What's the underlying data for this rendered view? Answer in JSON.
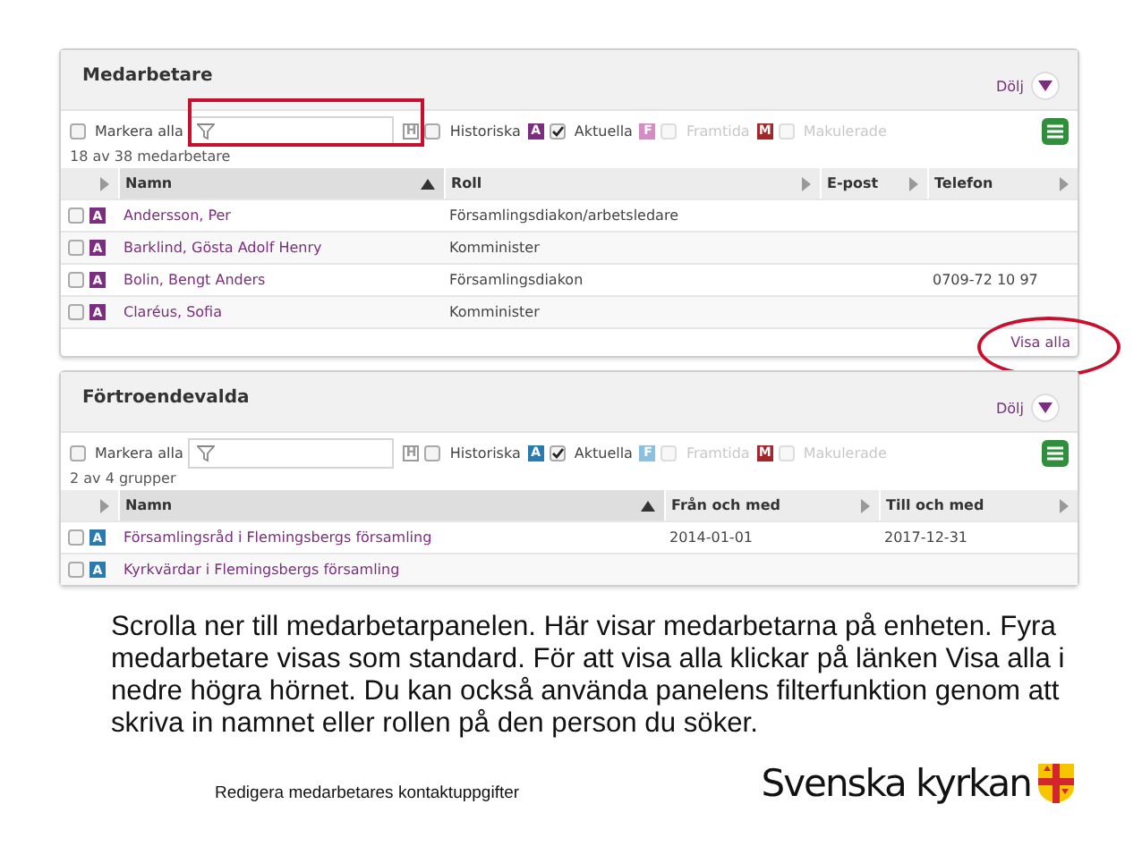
{
  "panels": [
    {
      "title": "Medarbetare",
      "hide_label": "Dölj",
      "select_all": {
        "label": "Markera alla",
        "checked": false
      },
      "highlight_filter": true,
      "filters": [
        {
          "badge": "H",
          "label": "Historiska",
          "checked": false,
          "disabled": false,
          "color": "#9a9a9a"
        },
        {
          "badge": "A",
          "label": "Aktuella",
          "checked": true,
          "disabled": false,
          "color": "#7b2d7f"
        },
        {
          "badge": "F",
          "label": "Framtida",
          "checked": false,
          "disabled": true,
          "color": "#d48cc4"
        },
        {
          "badge": "M",
          "label": "Makulerade",
          "checked": false,
          "disabled": true,
          "color": "#a3262a"
        }
      ],
      "count": "18 av 38 medarbetare",
      "columns": [
        {
          "label": "Namn",
          "sorted": true
        },
        {
          "label": "Roll",
          "sorted": false
        },
        {
          "label": "E-post",
          "sorted": false
        },
        {
          "label": "Telefon",
          "sorted": false
        }
      ],
      "rows": [
        {
          "checked": false,
          "badge": "A",
          "color": "#7b2d7f",
          "cells": [
            "Andersson, Per",
            "Församlingsdiakon/arbetsledare",
            "",
            ""
          ]
        },
        {
          "checked": false,
          "badge": "A",
          "color": "#7b2d7f",
          "cells": [
            "Barklind, Gösta Adolf Henry",
            "Komminister",
            "",
            ""
          ]
        },
        {
          "checked": false,
          "badge": "A",
          "color": "#7b2d7f",
          "cells": [
            "Bolin, Bengt Anders",
            "Församlingsdiakon",
            "",
            "0709-72 10 97"
          ]
        },
        {
          "checked": false,
          "badge": "A",
          "color": "#7b2d7f",
          "cells": [
            "Claréus, Sofia",
            "Komminister",
            "",
            ""
          ]
        }
      ],
      "footer_link": "Visa alla",
      "highlight_footer": true
    },
    {
      "title": "Förtroendevalda",
      "hide_label": "Dölj",
      "select_all": {
        "label": "Markera alla",
        "checked": false
      },
      "highlight_filter": false,
      "filters": [
        {
          "badge": "H",
          "label": "Historiska",
          "checked": false,
          "disabled": false,
          "color": "#9a9a9a"
        },
        {
          "badge": "A",
          "label": "Aktuella",
          "checked": true,
          "disabled": false,
          "color": "#2a7ab0"
        },
        {
          "badge": "F",
          "label": "Framtida",
          "checked": false,
          "disabled": true,
          "color": "#8cc0e0"
        },
        {
          "badge": "M",
          "label": "Makulerade",
          "checked": false,
          "disabled": true,
          "color": "#a3262a"
        }
      ],
      "count": "2 av 4 grupper",
      "columns": [
        {
          "label": "Namn",
          "sorted": true
        },
        {
          "label": "Från och med",
          "sorted": false
        },
        {
          "label": "Till och med",
          "sorted": false
        }
      ],
      "rows": [
        {
          "checked": false,
          "badge": "A",
          "color": "#2a7ab0",
          "cells": [
            "Församlingsråd i Flemingsbergs församling",
            "2014-01-01",
            "2017-12-31"
          ]
        },
        {
          "checked": false,
          "badge": "A",
          "color": "#2a7ab0",
          "cells": [
            "Kyrkvärdar i Flemingsbergs församling",
            "",
            ""
          ]
        }
      ],
      "highlight_footer": false
    }
  ],
  "caption": "Scrolla ner till medarbetarpanelen. Här visar medarbetarna på enheten. Fyra medarbetare visas som standard. För att visa alla klickar på länken Visa alla i nedre högra hörnet. Du kan också använda panelens filterfunktion genom att skriva in namnet eller rollen på den person du söker.",
  "footer_note": "Redigera medarbetares kontaktuppgifter",
  "logo": {
    "text": "Svenska kyrkan"
  }
}
